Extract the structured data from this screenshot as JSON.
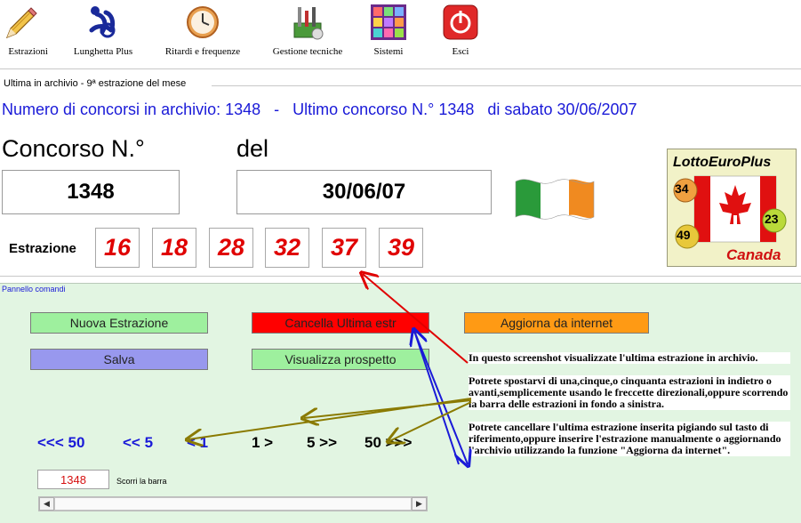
{
  "toolbar": {
    "items": [
      {
        "label": "Estrazioni",
        "icon": "pencil-icon"
      },
      {
        "label": "Lunghetta Plus",
        "icon": "lottery-logo-icon"
      },
      {
        "label": "Ritardi e frequenze",
        "icon": "clock-icon"
      },
      {
        "label": "Gestione tecniche",
        "icon": "tools-icon"
      },
      {
        "label": "Sistemi",
        "icon": "grid-icon"
      },
      {
        "label": "Esci",
        "icon": "exit-icon"
      }
    ]
  },
  "archive_caption": "Ultima in archivio - 9ª estrazione del mese",
  "summary": "Numero di concorsi in archivio: 1348   -   Ultimo concorso N.° 1348   di sabato 30/06/2007",
  "concorso": {
    "label": "Concorso N.°",
    "value": "1348"
  },
  "date": {
    "label": "del",
    "value": "30/06/07"
  },
  "estrazione": {
    "label": "Estrazione",
    "numbers": [
      "16",
      "18",
      "28",
      "32",
      "37",
      "39"
    ]
  },
  "logo": {
    "title": "LottoEuroPlus",
    "country": "Canada",
    "balls": [
      "34",
      "23",
      "49"
    ]
  },
  "panel": {
    "title": "Pannello comandi",
    "buttons": {
      "nuova": "Nuova Estrazione",
      "cancella": "Cancella Ultima estr",
      "aggiorna": "Aggiorna da internet",
      "salva": "Salva",
      "visualizza": "Visualizza prospetto"
    },
    "nav": [
      "<<< 50",
      "<< 5",
      "< 1",
      "1 >",
      "5 >>",
      "50 >>>"
    ],
    "counter": "1348",
    "scroll_label": "Scorri la barra"
  },
  "notes": [
    "In questo screenshot visualizzate l'ultima estrazione in archivio.",
    "Potrete spostarvi di una,cinque,o cinquanta estrazioni in indietro o avanti,semplicemente usando le freccette direzionali,oppure scorrendo la barra delle estrazioni in fondo a sinistra.",
    "Potrete cancellare l'ultima estrazione inserita pigiando sul tasto di riferimento,oppure inserire l'estrazione manualmente o aggiornando l'archivio utilizzando la funzione \"Aggiorna da internet\"."
  ],
  "colors": {
    "summary_text": "#1a1ad8",
    "panel_bg": "#e2f5e2",
    "button_green": "#9ef09e",
    "button_red": "#ff0000",
    "button_orange": "#ff9a14",
    "button_purple": "#9898ee",
    "number_red": "#e00000",
    "arrow_red": "#e00000",
    "arrow_olive": "#8a7a00",
    "arrow_blue": "#1a1ad8"
  }
}
